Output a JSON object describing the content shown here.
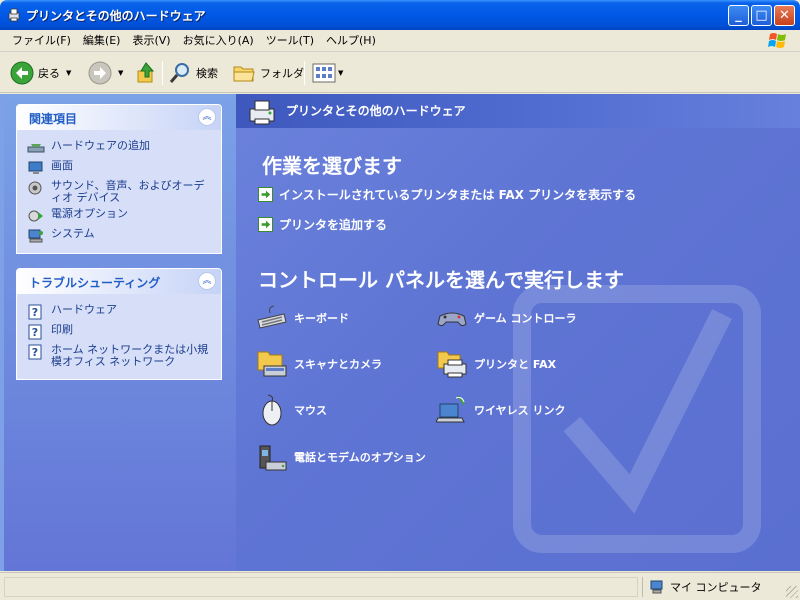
{
  "window": {
    "title": "プリンタとその他のハードウェア",
    "minimize_glyph": "_",
    "maximize_glyph": "□",
    "close_glyph": "✕"
  },
  "menu": {
    "items": [
      "ファイル(F)",
      "編集(E)",
      "表示(V)",
      "お気に入り(A)",
      "ツール(T)",
      "ヘルプ(H)"
    ]
  },
  "toolbar": {
    "back_label": "戻る",
    "search_label": "検索",
    "folder_label": "フォルダ"
  },
  "left_panels": {
    "related": {
      "title": "関連項目",
      "items": [
        "ハードウェアの追加",
        "画面",
        "サウンド、音声、およびオーディオ デバイス",
        "電源オプション",
        "システム"
      ]
    },
    "troubleshoot": {
      "title": "トラブルシューティング",
      "items": [
        "ハードウェア",
        "印刷",
        "ホーム ネットワークまたは小規模オフィス ネットワーク"
      ]
    }
  },
  "main": {
    "header": "プリンタとその他のハードウェア",
    "pick_task_title": "作業を選びます",
    "tasks": [
      "インストールされているプリンタまたは FAX プリンタを表示する",
      "プリンタを追加する"
    ],
    "pick_cp_title": "コントロール パネルを選んで実行します",
    "cp_items": {
      "keyboard": "キーボード",
      "game": "ゲーム コントローラ",
      "scanner": "スキャナとカメラ",
      "printer": "プリンタと FAX",
      "mouse": "マウス",
      "wireless": "ワイヤレス リンク",
      "phone": "電話とモデムのオプション"
    }
  },
  "status": {
    "location": "マイ コンピュータ"
  },
  "colors": {
    "title_blue": "#0058e6",
    "pane_blue": "#5f75d4",
    "link_blue": "#1c3c8e",
    "panel_title": "#215dc6"
  },
  "icons": {
    "back": "back-arrow-icon",
    "forward": "forward-arrow-icon",
    "up": "up-folder-icon",
    "search": "magnifier-icon",
    "folders": "folder-icon",
    "views": "views-grid-icon"
  }
}
